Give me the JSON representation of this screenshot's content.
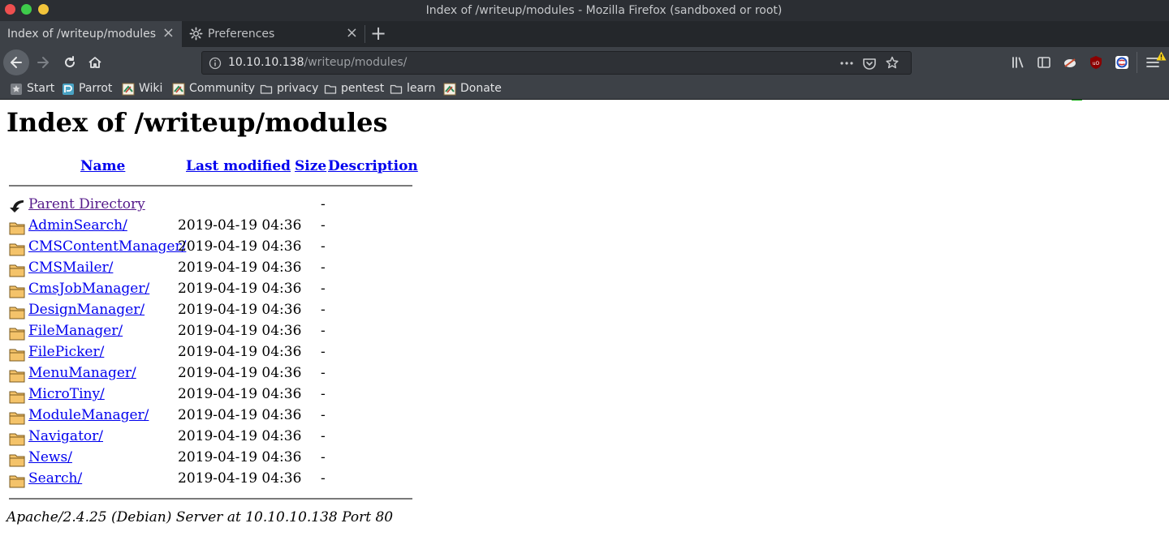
{
  "window": {
    "title": "Index of /writeup/modules - Mozilla Firefox (sandboxed or root)"
  },
  "tabs": [
    {
      "label": "Index of /writeup/modules",
      "active": true
    },
    {
      "label": "Preferences",
      "active": false
    }
  ],
  "tab_close_glyph": "×",
  "new_tab_glyph": "+",
  "urlbar": {
    "host": "10.10.10.138",
    "path": "/writeup/modules/"
  },
  "toolbar": {
    "extension_badge": "0"
  },
  "bookmarks": [
    {
      "label": "Start",
      "icon": "start-bookmark-icon"
    },
    {
      "label": "Parrot",
      "icon": "parrot-logo-icon"
    },
    {
      "label": "Wiki",
      "icon": "parrot-wiki-icon"
    },
    {
      "label": "Community",
      "icon": "parrot-community-icon"
    },
    {
      "label": "privacy",
      "icon": "folder-icon"
    },
    {
      "label": "pentest",
      "icon": "folder-icon"
    },
    {
      "label": "learn",
      "icon": "folder-icon"
    },
    {
      "label": "Donate",
      "icon": "parrot-donate-icon"
    }
  ],
  "page": {
    "heading": "Index of /writeup/modules",
    "columns": {
      "name": "Name",
      "last_modified": "Last modified",
      "size": "Size",
      "description": "Description"
    },
    "parent": {
      "name": "Parent Directory",
      "date": "",
      "size": "-"
    },
    "rows": [
      {
        "name": "AdminSearch/",
        "date": "2019-04-19 04:36",
        "size": "-"
      },
      {
        "name": "CMSContentManager/",
        "date": "2019-04-19 04:36",
        "size": "-"
      },
      {
        "name": "CMSMailer/",
        "date": "2019-04-19 04:36",
        "size": "-"
      },
      {
        "name": "CmsJobManager/",
        "date": "2019-04-19 04:36",
        "size": "-"
      },
      {
        "name": "DesignManager/",
        "date": "2019-04-19 04:36",
        "size": "-"
      },
      {
        "name": "FileManager/",
        "date": "2019-04-19 04:36",
        "size": "-"
      },
      {
        "name": "FilePicker/",
        "date": "2019-04-19 04:36",
        "size": "-"
      },
      {
        "name": "MenuManager/",
        "date": "2019-04-19 04:36",
        "size": "-"
      },
      {
        "name": "MicroTiny/",
        "date": "2019-04-19 04:36",
        "size": "-"
      },
      {
        "name": "ModuleManager/",
        "date": "2019-04-19 04:36",
        "size": "-"
      },
      {
        "name": "Navigator/",
        "date": "2019-04-19 04:36",
        "size": "-"
      },
      {
        "name": "News/",
        "date": "2019-04-19 04:36",
        "size": "-"
      },
      {
        "name": "Search/",
        "date": "2019-04-19 04:36",
        "size": "-"
      }
    ],
    "footer": "Apache/2.4.25 (Debian) Server at 10.10.10.138 Port 80"
  },
  "colors": {
    "link": "#0000ee",
    "visited_link": "#551a8b",
    "chrome_dark": "#2b2e33",
    "toolbar": "#3d4147",
    "folder": "#f4c36a"
  }
}
